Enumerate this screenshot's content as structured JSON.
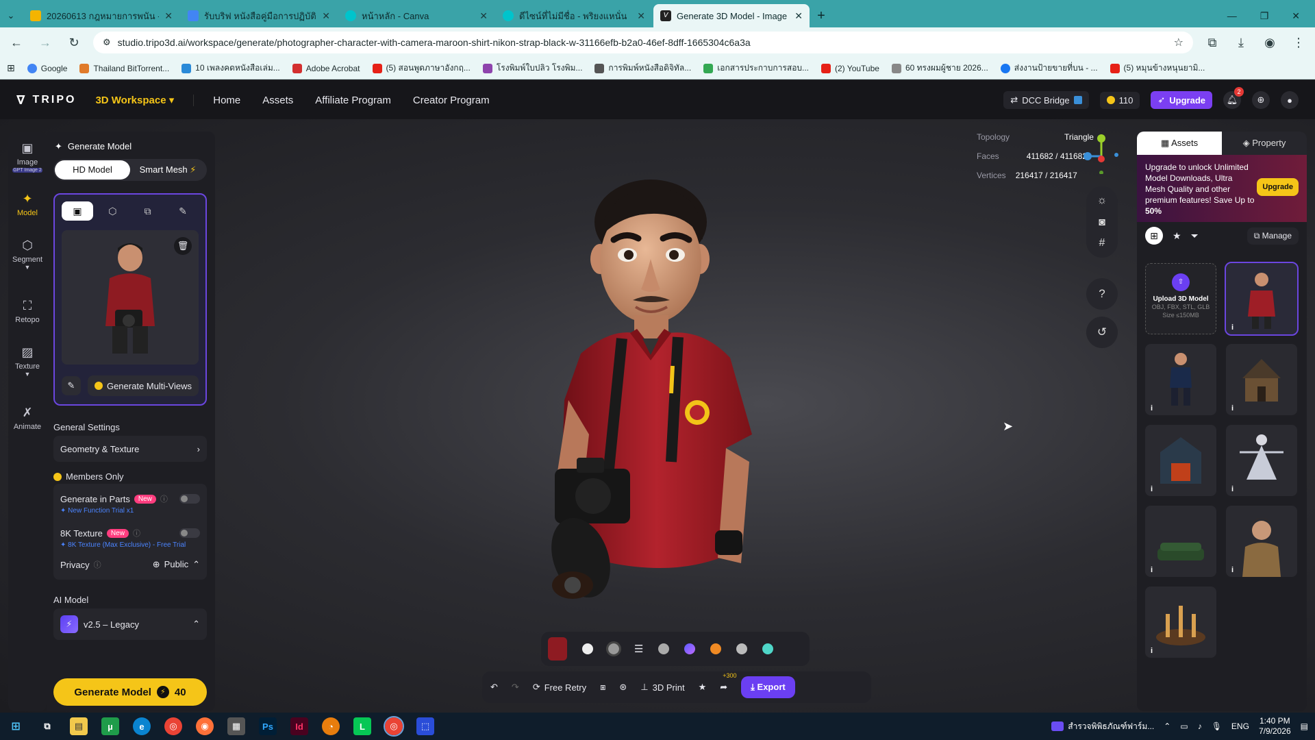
{
  "browser": {
    "tabs": [
      {
        "title": "20260613 กฎหมายการพนัน - Goo",
        "color": "#f4b400"
      },
      {
        "title": "รับบริฟ หนังสือคู่มือการปฏิบัติงานตาม",
        "color": "#4285f4"
      },
      {
        "title": "หน้าหลัก - Canva",
        "color": "#00c4cc"
      },
      {
        "title": "ดีไซน์ที่ไม่มีชื่อ - พริยงแหนั่น",
        "color": "#00c4cc"
      },
      {
        "title": "Generate 3D Model - Image an",
        "color": "#222222",
        "active": true
      }
    ],
    "url": "studio.tripo3d.ai/workspace/generate/photographer-character-with-camera-maroon-shirt-nikon-strap-black-w-31166efb-b2a0-46ef-8dff-1665304c6a3a",
    "bookmarks": [
      {
        "label": "Google",
        "color": "#4285f4"
      },
      {
        "label": "Thailand BitTorrent...",
        "color": "#e07b2a"
      },
      {
        "label": "10 เพลงคดหนังสือเล่ม...",
        "color": "#2a8ad8"
      },
      {
        "label": "Adobe Acrobat",
        "color": "#d32f2f"
      },
      {
        "label": "(5) สอนพูดภาษาอังกฤ...",
        "color": "#e62117"
      },
      {
        "label": "โรงพิมพ์ใบปลิว โรงพิม...",
        "color": "#8e44ad"
      },
      {
        "label": "การพิมพ์หนังสือดิจิทัล...",
        "color": "#555555"
      },
      {
        "label": "เอกสารประกาบการสอบ...",
        "color": "#34a853"
      },
      {
        "label": "(2) YouTube",
        "color": "#e62117"
      },
      {
        "label": "60 ทรงผมผู้ชาย 2026...",
        "color": "#888888"
      },
      {
        "label": "ส่งงานป้ายขายที่บน - ...",
        "color": "#1877f2"
      },
      {
        "label": "(5) หมุนข้างหนุนยามิ...",
        "color": "#e62117"
      }
    ]
  },
  "app": {
    "logo": "TRIPO",
    "workspace": "3D Workspace",
    "nav": [
      "Home",
      "Assets",
      "Affiliate Program",
      "Creator Program"
    ],
    "dcc": "DCC Bridge",
    "credits": "110",
    "upgrade": "Upgrade",
    "notifications": "2"
  },
  "rail": [
    {
      "label": "Image",
      "badge": "GPT Image 2"
    },
    {
      "label": "Model",
      "active": true
    },
    {
      "label": "Segment"
    },
    {
      "label": "Retopo"
    },
    {
      "label": "Texture"
    },
    {
      "label": "Animate"
    }
  ],
  "panel": {
    "title": "Generate Model",
    "mode_hd": "HD Model",
    "mode_smart": "Smart Mesh",
    "gen_multiviews": "Generate Multi-Views",
    "general_settings": "General Settings",
    "geometry_texture": "Geometry & Texture",
    "members_only": "Members Only",
    "gen_parts": "Generate in Parts",
    "gen_parts_sub": "New Function Trial x1",
    "tex8k": "8K Texture",
    "tex8k_sub": "8K Texture (Max Exclusive) - Free Trial",
    "new_badge": "New",
    "privacy": "Privacy",
    "privacy_value": "Public",
    "ai_model": "AI Model",
    "ai_model_value": "v2.5 – Legacy",
    "generate": "Generate Model",
    "generate_cost": "40"
  },
  "viewport": {
    "topology_label": "Topology",
    "topology_value": "Triangle",
    "faces_label": "Faces",
    "faces_value": "411682 / 411682",
    "vertices_label": "Vertices",
    "vertices_value": "216417 / 216417"
  },
  "bottombar": {
    "free_retry": "Free Retry",
    "print": "3D Print",
    "share_badge": "+300",
    "export": "Export"
  },
  "right": {
    "tab_assets": "Assets",
    "tab_property": "Property",
    "promo_prefix": "Upgrade to unlock Unlimited Model Downloads, Ultra Mesh Quality and other premium features!  Save Up to ",
    "promo_highlight": "50%",
    "promo_button": "Upgrade",
    "manage": "Manage",
    "upload_title": "Upload 3D Model",
    "upload_formats": "OBJ, FBX, STL, GLB",
    "upload_size": "Size ≤150MB",
    "info": "i"
  },
  "taskbar": {
    "notification_text": "สำรวจพิพิธภัณฑ์ฟาร์ม...",
    "lang": "ENG",
    "time": "1:40 PM",
    "date": "7/9/2026"
  }
}
